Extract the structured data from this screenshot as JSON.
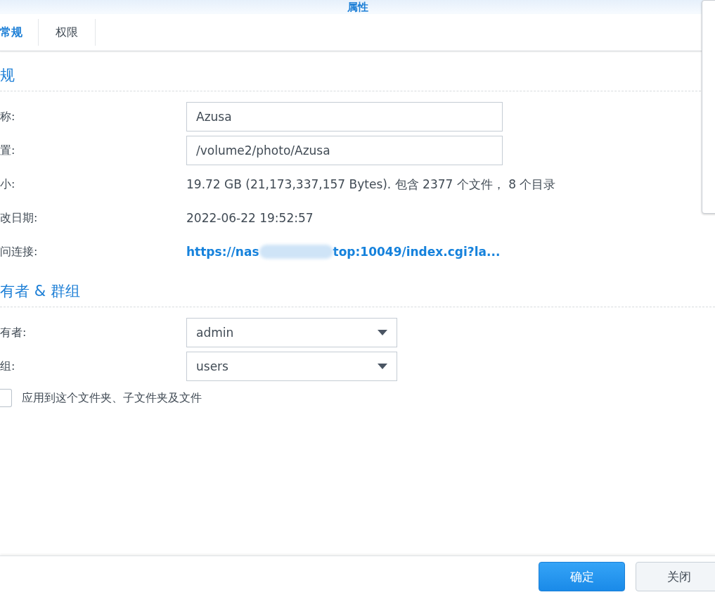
{
  "window": {
    "title": "属性"
  },
  "tabs": [
    {
      "label": "常规",
      "selected": true
    },
    {
      "label": "权限",
      "selected": false
    }
  ],
  "sections": [
    {
      "heading": "规",
      "rows": [
        {
          "kind": "input",
          "label": "称:",
          "value": "Azusa"
        },
        {
          "kind": "input",
          "label": "置:",
          "value": "/volume2/photo/Azusa"
        },
        {
          "kind": "text",
          "label": "小:",
          "value": "19.72 GB (21,173,337,157 Bytes). 包含 2377 个文件， 8 个目录"
        },
        {
          "kind": "text",
          "label": "改日期:",
          "value": "2022-06-22 19:52:57"
        },
        {
          "kind": "link",
          "label": "问连接:",
          "value": "https://nas",
          "value_end": "top:10049/index.cgi?la..."
        }
      ]
    },
    {
      "heading": "有者 & 群组",
      "rows": [
        {
          "kind": "select",
          "label": "有者:",
          "value": "admin"
        },
        {
          "kind": "select",
          "label": "组:",
          "value": "users"
        }
      ]
    }
  ],
  "apply_checkbox": {
    "label": "应用到这个文件夹、子文件夹及文件",
    "checked": false
  },
  "buttons": [
    {
      "label": "确定",
      "primary": true
    },
    {
      "label": "关闭",
      "primary": false
    }
  ]
}
